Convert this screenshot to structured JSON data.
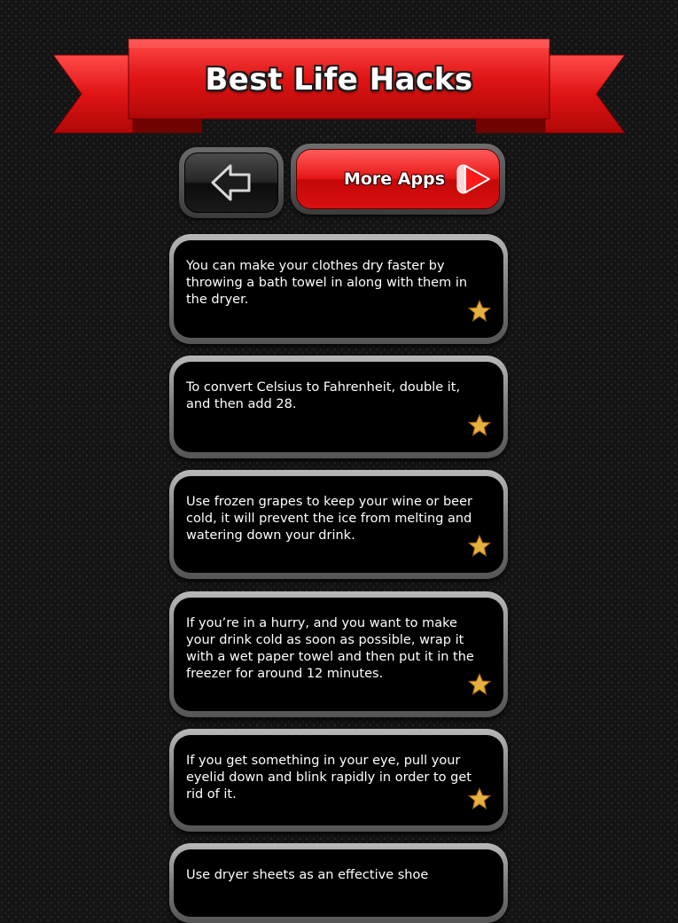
{
  "header": {
    "title": "Best Life Hacks"
  },
  "toolbar": {
    "back_icon": "arrow-left-icon",
    "more_apps_label": "More Apps",
    "more_apps_icon": "play-icon"
  },
  "colors": {
    "ribbon_red": "#e01414",
    "button_red": "#e81818",
    "card_background": "#000000",
    "star_gold": "#e8b040",
    "page_background": "#141414"
  },
  "hacks": [
    {
      "text": "You can make your clothes dry faster by throwing a bath towel in along with them in the dryer.",
      "favorite_icon": "star-icon"
    },
    {
      "text": "To convert Celsius to Fahrenheit, double it, and then add 28.",
      "favorite_icon": "star-icon"
    },
    {
      "text": "Use frozen grapes to keep your wine or beer cold, it will prevent the ice from melting and watering down your drink.",
      "favorite_icon": "star-icon"
    },
    {
      "text": "If you’re in a hurry, and you want to make your drink cold as soon as possible, wrap it with a wet paper towel and then put it in the freezer for around 12 minutes.",
      "favorite_icon": "star-icon"
    },
    {
      "text": "If you get something in your eye, pull your eyelid down and blink rapidly in order to get rid of it.",
      "favorite_icon": "star-icon"
    },
    {
      "text": "Use dryer sheets as an effective shoe",
      "favorite_icon": "star-icon"
    }
  ]
}
